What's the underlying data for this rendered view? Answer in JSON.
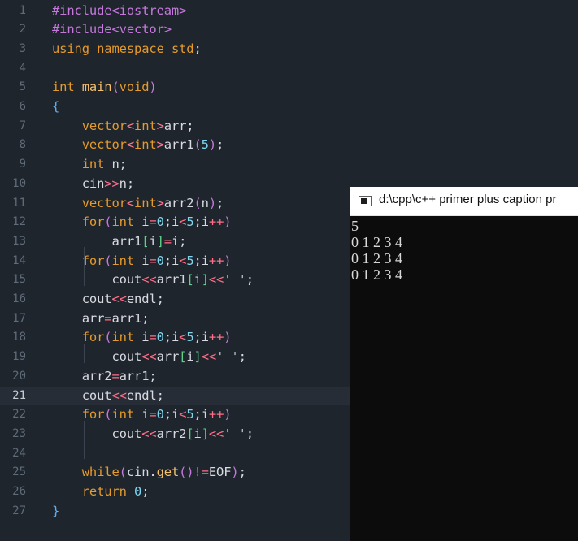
{
  "editor": {
    "active_line": 21,
    "lines": [
      {
        "number": "1",
        "tokens": [
          {
            "t": "#include",
            "c": "tok-dir"
          },
          {
            "t": "<",
            "c": "tok-dir"
          },
          {
            "t": "iostream",
            "c": "tok-dir"
          },
          {
            "t": ">",
            "c": "tok-dir"
          }
        ]
      },
      {
        "number": "2",
        "tokens": [
          {
            "t": "#include",
            "c": "tok-dir"
          },
          {
            "t": "<",
            "c": "tok-dir"
          },
          {
            "t": "vector",
            "c": "tok-dir"
          },
          {
            "t": ">",
            "c": "tok-dir"
          }
        ]
      },
      {
        "number": "3",
        "tokens": [
          {
            "t": "using",
            "c": "tok-kw"
          },
          {
            "t": " ",
            "c": "tok-id"
          },
          {
            "t": "namespace",
            "c": "tok-kw"
          },
          {
            "t": " ",
            "c": "tok-id"
          },
          {
            "t": "std",
            "c": "tok-kw"
          },
          {
            "t": ";",
            "c": "tok-punct"
          }
        ]
      },
      {
        "number": "4",
        "tokens": []
      },
      {
        "number": "5",
        "tokens": [
          {
            "t": "int",
            "c": "tok-type"
          },
          {
            "t": " ",
            "c": "tok-id"
          },
          {
            "t": "main",
            "c": "tok-fn"
          },
          {
            "t": "(",
            "c": "tok-paren"
          },
          {
            "t": "void",
            "c": "tok-kw"
          },
          {
            "t": ")",
            "c": "tok-paren"
          }
        ]
      },
      {
        "number": "6",
        "tokens": [
          {
            "t": "{",
            "c": "tok-brace"
          }
        ]
      },
      {
        "number": "7",
        "tokens": [
          {
            "t": "    ",
            "c": "tok-id"
          },
          {
            "t": "vector",
            "c": "tok-type"
          },
          {
            "t": "<",
            "c": "tok-angle"
          },
          {
            "t": "int",
            "c": "tok-type"
          },
          {
            "t": ">",
            "c": "tok-angle"
          },
          {
            "t": "arr",
            "c": "tok-id"
          },
          {
            "t": ";",
            "c": "tok-punct"
          }
        ]
      },
      {
        "number": "8",
        "tokens": [
          {
            "t": "    ",
            "c": "tok-id"
          },
          {
            "t": "vector",
            "c": "tok-type"
          },
          {
            "t": "<",
            "c": "tok-angle"
          },
          {
            "t": "int",
            "c": "tok-type"
          },
          {
            "t": ">",
            "c": "tok-angle"
          },
          {
            "t": "arr1",
            "c": "tok-id"
          },
          {
            "t": "(",
            "c": "tok-paren"
          },
          {
            "t": "5",
            "c": "tok-num"
          },
          {
            "t": ")",
            "c": "tok-paren"
          },
          {
            "t": ";",
            "c": "tok-punct"
          }
        ]
      },
      {
        "number": "9",
        "tokens": [
          {
            "t": "    ",
            "c": "tok-id"
          },
          {
            "t": "int",
            "c": "tok-type"
          },
          {
            "t": " n",
            "c": "tok-id"
          },
          {
            "t": ";",
            "c": "tok-punct"
          }
        ]
      },
      {
        "number": "10",
        "tokens": [
          {
            "t": "    ",
            "c": "tok-id"
          },
          {
            "t": "cin",
            "c": "tok-id"
          },
          {
            "t": ">>",
            "c": "tok-op"
          },
          {
            "t": "n",
            "c": "tok-id"
          },
          {
            "t": ";",
            "c": "tok-punct"
          }
        ]
      },
      {
        "number": "11",
        "tokens": [
          {
            "t": "    ",
            "c": "tok-id"
          },
          {
            "t": "vector",
            "c": "tok-type"
          },
          {
            "t": "<",
            "c": "tok-angle"
          },
          {
            "t": "int",
            "c": "tok-type"
          },
          {
            "t": ">",
            "c": "tok-angle"
          },
          {
            "t": "arr2",
            "c": "tok-id"
          },
          {
            "t": "(",
            "c": "tok-paren"
          },
          {
            "t": "n",
            "c": "tok-id"
          },
          {
            "t": ")",
            "c": "tok-paren"
          },
          {
            "t": ";",
            "c": "tok-punct"
          }
        ]
      },
      {
        "number": "12",
        "tokens": [
          {
            "t": "    ",
            "c": "tok-id"
          },
          {
            "t": "for",
            "c": "tok-kw"
          },
          {
            "t": "(",
            "c": "tok-paren"
          },
          {
            "t": "int",
            "c": "tok-type"
          },
          {
            "t": " i",
            "c": "tok-id"
          },
          {
            "t": "=",
            "c": "tok-op"
          },
          {
            "t": "0",
            "c": "tok-num"
          },
          {
            "t": ";",
            "c": "tok-punct"
          },
          {
            "t": "i",
            "c": "tok-id"
          },
          {
            "t": "<",
            "c": "tok-op"
          },
          {
            "t": "5",
            "c": "tok-num"
          },
          {
            "t": ";",
            "c": "tok-punct"
          },
          {
            "t": "i",
            "c": "tok-id"
          },
          {
            "t": "++",
            "c": "tok-op"
          },
          {
            "t": ")",
            "c": "tok-paren"
          }
        ]
      },
      {
        "number": "13",
        "tokens": [
          {
            "t": "        ",
            "c": "tok-id"
          },
          {
            "t": "arr1",
            "c": "tok-id"
          },
          {
            "t": "[",
            "c": "tok-bracket"
          },
          {
            "t": "i",
            "c": "tok-id"
          },
          {
            "t": "]",
            "c": "tok-bracket"
          },
          {
            "t": "=",
            "c": "tok-op"
          },
          {
            "t": "i",
            "c": "tok-id"
          },
          {
            "t": ";",
            "c": "tok-punct"
          }
        ]
      },
      {
        "number": "14",
        "tokens": [
          {
            "t": "    ",
            "c": "tok-id"
          },
          {
            "t": "for",
            "c": "tok-kw"
          },
          {
            "t": "(",
            "c": "tok-paren"
          },
          {
            "t": "int",
            "c": "tok-type"
          },
          {
            "t": " i",
            "c": "tok-id"
          },
          {
            "t": "=",
            "c": "tok-op"
          },
          {
            "t": "0",
            "c": "tok-num"
          },
          {
            "t": ";",
            "c": "tok-punct"
          },
          {
            "t": "i",
            "c": "tok-id"
          },
          {
            "t": "<",
            "c": "tok-op"
          },
          {
            "t": "5",
            "c": "tok-num"
          },
          {
            "t": ";",
            "c": "tok-punct"
          },
          {
            "t": "i",
            "c": "tok-id"
          },
          {
            "t": "++",
            "c": "tok-op"
          },
          {
            "t": ")",
            "c": "tok-paren"
          }
        ]
      },
      {
        "number": "15",
        "tokens": [
          {
            "t": "        ",
            "c": "tok-id"
          },
          {
            "t": "cout",
            "c": "tok-id"
          },
          {
            "t": "<<",
            "c": "tok-op"
          },
          {
            "t": "arr1",
            "c": "tok-id"
          },
          {
            "t": "[",
            "c": "tok-bracket"
          },
          {
            "t": "i",
            "c": "tok-id"
          },
          {
            "t": "]",
            "c": "tok-bracket"
          },
          {
            "t": "<<",
            "c": "tok-op"
          },
          {
            "t": "' '",
            "c": "tok-str"
          },
          {
            "t": ";",
            "c": "tok-punct"
          }
        ]
      },
      {
        "number": "16",
        "tokens": [
          {
            "t": "    ",
            "c": "tok-id"
          },
          {
            "t": "cout",
            "c": "tok-id"
          },
          {
            "t": "<<",
            "c": "tok-op"
          },
          {
            "t": "endl",
            "c": "tok-id"
          },
          {
            "t": ";",
            "c": "tok-punct"
          }
        ]
      },
      {
        "number": "17",
        "tokens": [
          {
            "t": "    ",
            "c": "tok-id"
          },
          {
            "t": "arr",
            "c": "tok-id"
          },
          {
            "t": "=",
            "c": "tok-op"
          },
          {
            "t": "arr1",
            "c": "tok-id"
          },
          {
            "t": ";",
            "c": "tok-punct"
          }
        ]
      },
      {
        "number": "18",
        "tokens": [
          {
            "t": "    ",
            "c": "tok-id"
          },
          {
            "t": "for",
            "c": "tok-kw"
          },
          {
            "t": "(",
            "c": "tok-paren"
          },
          {
            "t": "int",
            "c": "tok-type"
          },
          {
            "t": " i",
            "c": "tok-id"
          },
          {
            "t": "=",
            "c": "tok-op"
          },
          {
            "t": "0",
            "c": "tok-num"
          },
          {
            "t": ";",
            "c": "tok-punct"
          },
          {
            "t": "i",
            "c": "tok-id"
          },
          {
            "t": "<",
            "c": "tok-op"
          },
          {
            "t": "5",
            "c": "tok-num"
          },
          {
            "t": ";",
            "c": "tok-punct"
          },
          {
            "t": "i",
            "c": "tok-id"
          },
          {
            "t": "++",
            "c": "tok-op"
          },
          {
            "t": ")",
            "c": "tok-paren"
          }
        ]
      },
      {
        "number": "19",
        "tokens": [
          {
            "t": "        ",
            "c": "tok-id"
          },
          {
            "t": "cout",
            "c": "tok-id"
          },
          {
            "t": "<<",
            "c": "tok-op"
          },
          {
            "t": "arr",
            "c": "tok-id"
          },
          {
            "t": "[",
            "c": "tok-bracket"
          },
          {
            "t": "i",
            "c": "tok-id"
          },
          {
            "t": "]",
            "c": "tok-bracket"
          },
          {
            "t": "<<",
            "c": "tok-op"
          },
          {
            "t": "' '",
            "c": "tok-str"
          },
          {
            "t": ";",
            "c": "tok-punct"
          }
        ]
      },
      {
        "number": "20",
        "tokens": [
          {
            "t": "    ",
            "c": "tok-id"
          },
          {
            "t": "arr2",
            "c": "tok-id"
          },
          {
            "t": "=",
            "c": "tok-op"
          },
          {
            "t": "arr1",
            "c": "tok-id"
          },
          {
            "t": ";",
            "c": "tok-punct"
          }
        ]
      },
      {
        "number": "21",
        "tokens": [
          {
            "t": "    ",
            "c": "tok-id"
          },
          {
            "t": "cout",
            "c": "tok-id"
          },
          {
            "t": "<<",
            "c": "tok-op"
          },
          {
            "t": "endl",
            "c": "tok-id"
          },
          {
            "t": ";",
            "c": "tok-punct"
          }
        ]
      },
      {
        "number": "22",
        "tokens": [
          {
            "t": "    ",
            "c": "tok-id"
          },
          {
            "t": "for",
            "c": "tok-kw"
          },
          {
            "t": "(",
            "c": "tok-paren"
          },
          {
            "t": "int",
            "c": "tok-type"
          },
          {
            "t": " i",
            "c": "tok-id"
          },
          {
            "t": "=",
            "c": "tok-op"
          },
          {
            "t": "0",
            "c": "tok-num"
          },
          {
            "t": ";",
            "c": "tok-punct"
          },
          {
            "t": "i",
            "c": "tok-id"
          },
          {
            "t": "<",
            "c": "tok-op"
          },
          {
            "t": "5",
            "c": "tok-num"
          },
          {
            "t": ";",
            "c": "tok-punct"
          },
          {
            "t": "i",
            "c": "tok-id"
          },
          {
            "t": "++",
            "c": "tok-op"
          },
          {
            "t": ")",
            "c": "tok-paren"
          }
        ]
      },
      {
        "number": "23",
        "tokens": [
          {
            "t": "        ",
            "c": "tok-id"
          },
          {
            "t": "cout",
            "c": "tok-id"
          },
          {
            "t": "<<",
            "c": "tok-op"
          },
          {
            "t": "arr2",
            "c": "tok-id"
          },
          {
            "t": "[",
            "c": "tok-bracket"
          },
          {
            "t": "i",
            "c": "tok-id"
          },
          {
            "t": "]",
            "c": "tok-bracket"
          },
          {
            "t": "<<",
            "c": "tok-op"
          },
          {
            "t": "' '",
            "c": "tok-str"
          },
          {
            "t": ";",
            "c": "tok-punct"
          }
        ]
      },
      {
        "number": "24",
        "tokens": []
      },
      {
        "number": "25",
        "tokens": [
          {
            "t": "    ",
            "c": "tok-id"
          },
          {
            "t": "while",
            "c": "tok-kw"
          },
          {
            "t": "(",
            "c": "tok-paren"
          },
          {
            "t": "cin",
            "c": "tok-id"
          },
          {
            "t": ".",
            "c": "tok-punct"
          },
          {
            "t": "get",
            "c": "tok-fn"
          },
          {
            "t": "()",
            "c": "tok-paren"
          },
          {
            "t": "!=",
            "c": "tok-op"
          },
          {
            "t": "EOF",
            "c": "tok-id"
          },
          {
            "t": ")",
            "c": "tok-paren"
          },
          {
            "t": ";",
            "c": "tok-punct"
          }
        ]
      },
      {
        "number": "26",
        "tokens": [
          {
            "t": "    ",
            "c": "tok-id"
          },
          {
            "t": "return",
            "c": "tok-kw"
          },
          {
            "t": " ",
            "c": "tok-id"
          },
          {
            "t": "0",
            "c": "tok-num"
          },
          {
            "t": ";",
            "c": "tok-punct"
          }
        ]
      },
      {
        "number": "27",
        "tokens": [
          {
            "t": "}",
            "c": "tok-brace"
          }
        ]
      }
    ]
  },
  "console": {
    "title": "d:\\cpp\\c++ primer plus caption pr",
    "icon": "console-window-icon",
    "output": [
      "5",
      "0 1 2 3 4",
      "0 1 2 3 4",
      "0 1 2 3 4"
    ]
  },
  "colors": {
    "editor_background": "#1f252d",
    "active_line_background": "#262d36",
    "console_background": "#0c0c0c",
    "console_text": "#d8d8d8"
  }
}
